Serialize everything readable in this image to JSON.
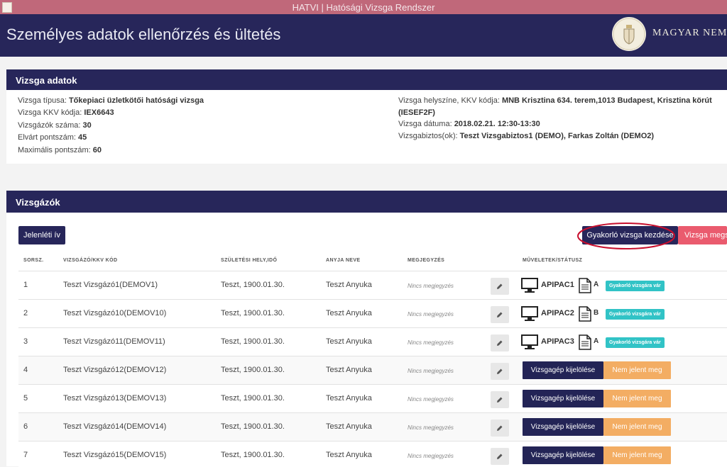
{
  "window": {
    "title": "HATVI | Hatósági Vizsga Rendszer"
  },
  "header": {
    "title": "Személyes adatok ellenőrzés és ültetés",
    "org_name": "MAGYAR NEMZ"
  },
  "exam": {
    "heading": "Vizsga adatok",
    "left": [
      {
        "label": "Vizsga típusa: ",
        "value": "Tőkepiaci üzletkötői hatósági vizsga"
      },
      {
        "label": "Vizsga KKV kódja: ",
        "value": "IEX6643"
      },
      {
        "label": "Vizsgázók száma: ",
        "value": "30"
      },
      {
        "label": "Elvárt pontszám: ",
        "value": "45"
      },
      {
        "label": "Maximális pontszám: ",
        "value": "60"
      }
    ],
    "location_label": "Vizsga helyszíne, KKV kódja: ",
    "location_value": "MNB Krisztina 634. terem,1013 Budapest, Krisztina körút",
    "location_code": "(IESEF2F)",
    "date_label": "Vizsga dátuma: ",
    "date_value": "2018.02.21. 12:30-13:30",
    "examiner_label": "Vizsgabiztos(ok): ",
    "examiner_value": "Teszt Vizsgabiztos1 (DEMO), Farkas Zoltán (DEMO2)"
  },
  "candidates": {
    "heading": "Vizsgázók",
    "attendance_button": "Jelenléti ív",
    "practice_button": "Gyakorló vizsga kezdése",
    "start_button": "Vizsga megs",
    "columns": [
      "SORSZ.",
      "VIZSGÁZÓ/KKV KÓD",
      "SZÜLETÉSI HELY,IDŐ",
      "ANYJA NEVE",
      "MEGJEGYZÉS",
      "MŰVELETEK/STÁTUSZ"
    ],
    "rows": [
      {
        "num": "1",
        "name": "Teszt Vizsgázó1(DEMOV1)",
        "birth": "Teszt, 1900.01.30.",
        "mother": "Teszt Anyuka",
        "note": "Nincs megjegyzés",
        "pc": "APIPAC1",
        "variant": "A",
        "status": "Gyakorló vizsgára vár"
      },
      {
        "num": "2",
        "name": "Teszt Vizsgázó10(DEMOV10)",
        "birth": "Teszt, 1900.01.30.",
        "mother": "Teszt Anyuka",
        "note": "Nincs megjegyzés",
        "pc": "APIPAC2",
        "variant": "B",
        "status": "Gyakorló vizsgára vár"
      },
      {
        "num": "3",
        "name": "Teszt Vizsgázó11(DEMOV11)",
        "birth": "Teszt, 1900.01.30.",
        "mother": "Teszt Anyuka",
        "note": "Nincs megjegyzés",
        "pc": "APIPAC3",
        "variant": "A",
        "status": "Gyakorló vizsgára vár"
      },
      {
        "num": "4",
        "name": "Teszt Vizsgázó12(DEMOV12)",
        "birth": "Teszt, 1900.01.30.",
        "mother": "Teszt Anyuka",
        "note": "Nincs megjegyzés",
        "assign": "Vizsgagép kijelölése",
        "absent": "Nem jelent meg"
      },
      {
        "num": "5",
        "name": "Teszt Vizsgázó13(DEMOV13)",
        "birth": "Teszt, 1900.01.30.",
        "mother": "Teszt Anyuka",
        "note": "Nincs megjegyzés",
        "assign": "Vizsgagép kijelölése",
        "absent": "Nem jelent meg"
      },
      {
        "num": "6",
        "name": "Teszt Vizsgázó14(DEMOV14)",
        "birth": "Teszt, 1900.01.30.",
        "mother": "Teszt Anyuka",
        "note": "Nincs megjegyzés",
        "assign": "Vizsgagép kijelölése",
        "absent": "Nem jelent meg"
      },
      {
        "num": "7",
        "name": "Teszt Vizsgázó15(DEMOV15)",
        "birth": "Teszt, 1900.01.30.",
        "mother": "Teszt Anyuka",
        "note": "Nincs megjegyzés",
        "assign": "Vizsgagép kijelölése",
        "absent": "Nem jelent meg"
      }
    ]
  },
  "colors": {
    "navy": "#27265a",
    "teal": "#31c3c6",
    "orange": "#f3ad63",
    "red": "#ea5b6e",
    "highlight_ring": "#c8102e"
  }
}
